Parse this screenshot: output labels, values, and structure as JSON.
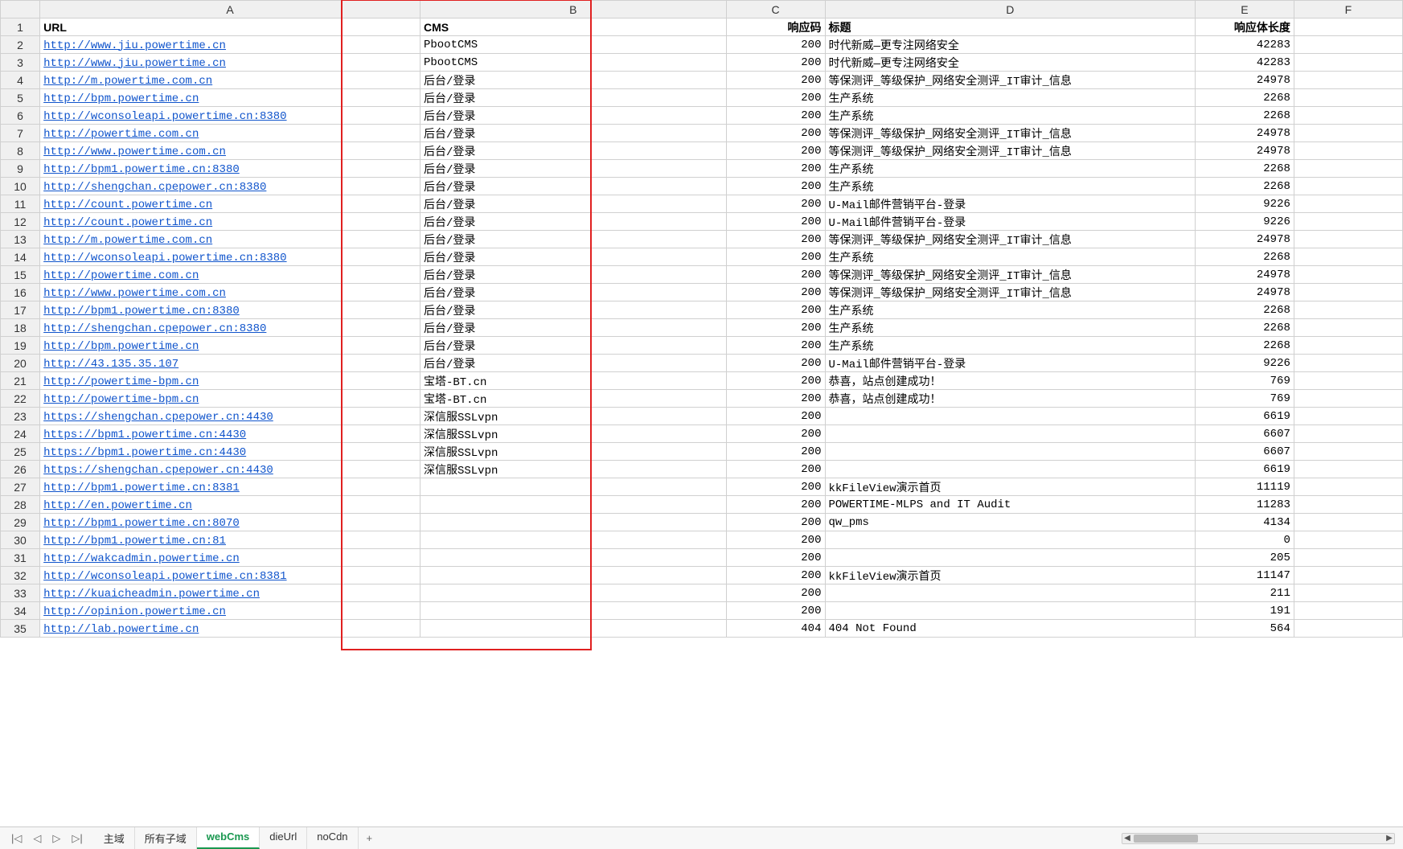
{
  "columns": [
    "A",
    "B",
    "C",
    "D",
    "E",
    "F"
  ],
  "headers": {
    "A": "URL",
    "B": "CMS",
    "C": "响应码",
    "D": "标题",
    "E": "响应体长度",
    "F": ""
  },
  "rows": [
    {
      "n": 2,
      "url": "http://www.jiu.powertime.cn",
      "cms": "PbootCMS",
      "code": "200",
      "title": "时代新威—更专注网络安全",
      "len": "42283"
    },
    {
      "n": 3,
      "url": "http://www.jiu.powertime.cn",
      "cms": "PbootCMS",
      "code": "200",
      "title": "时代新威—更专注网络安全",
      "len": "42283"
    },
    {
      "n": 4,
      "url": "http://m.powertime.com.cn",
      "cms": "后台/登录",
      "code": "200",
      "title": "等保测评_等级保护_网络安全测评_IT审计_信息",
      "len": "24978"
    },
    {
      "n": 5,
      "url": "http://bpm.powertime.cn",
      "cms": "后台/登录",
      "code": "200",
      "title": "生产系统",
      "len": "2268"
    },
    {
      "n": 6,
      "url": "http://wconsoleapi.powertime.cn:8380",
      "cms": "后台/登录",
      "code": "200",
      "title": "生产系统",
      "len": "2268"
    },
    {
      "n": 7,
      "url": "http://powertime.com.cn",
      "cms": "后台/登录",
      "code": "200",
      "title": "等保测评_等级保护_网络安全测评_IT审计_信息",
      "len": "24978"
    },
    {
      "n": 8,
      "url": "http://www.powertime.com.cn",
      "cms": "后台/登录",
      "code": "200",
      "title": "等保测评_等级保护_网络安全测评_IT审计_信息",
      "len": "24978"
    },
    {
      "n": 9,
      "url": "http://bpm1.powertime.cn:8380",
      "cms": "后台/登录",
      "code": "200",
      "title": "生产系统",
      "len": "2268"
    },
    {
      "n": 10,
      "url": "http://shengchan.cpepower.cn:8380",
      "cms": "后台/登录",
      "code": "200",
      "title": "生产系统",
      "len": "2268"
    },
    {
      "n": 11,
      "url": "http://count.powertime.cn",
      "cms": "后台/登录",
      "code": "200",
      "title": "U-Mail邮件营销平台-登录",
      "len": "9226"
    },
    {
      "n": 12,
      "url": "http://count.powertime.cn",
      "cms": "后台/登录",
      "code": "200",
      "title": "U-Mail邮件营销平台-登录",
      "len": "9226"
    },
    {
      "n": 13,
      "url": "http://m.powertime.com.cn",
      "cms": "后台/登录",
      "code": "200",
      "title": "等保测评_等级保护_网络安全测评_IT审计_信息",
      "len": "24978"
    },
    {
      "n": 14,
      "url": "http://wconsoleapi.powertime.cn:8380",
      "cms": "后台/登录",
      "code": "200",
      "title": "生产系统",
      "len": "2268"
    },
    {
      "n": 15,
      "url": "http://powertime.com.cn",
      "cms": "后台/登录",
      "code": "200",
      "title": "等保测评_等级保护_网络安全测评_IT审计_信息",
      "len": "24978"
    },
    {
      "n": 16,
      "url": "http://www.powertime.com.cn",
      "cms": "后台/登录",
      "code": "200",
      "title": "等保测评_等级保护_网络安全测评_IT审计_信息",
      "len": "24978"
    },
    {
      "n": 17,
      "url": "http://bpm1.powertime.cn:8380",
      "cms": "后台/登录",
      "code": "200",
      "title": "生产系统",
      "len": "2268"
    },
    {
      "n": 18,
      "url": "http://shengchan.cpepower.cn:8380",
      "cms": "后台/登录",
      "code": "200",
      "title": "生产系统",
      "len": "2268"
    },
    {
      "n": 19,
      "url": "http://bpm.powertime.cn",
      "cms": "后台/登录",
      "code": "200",
      "title": "生产系统",
      "len": "2268"
    },
    {
      "n": 20,
      "url": "http://43.135.35.107",
      "cms": "后台/登录",
      "code": "200",
      "title": "U-Mail邮件营销平台-登录",
      "len": "9226"
    },
    {
      "n": 21,
      "url": "http://powertime-bpm.cn",
      "cms": "宝塔-BT.cn",
      "code": "200",
      "title": "恭喜，站点创建成功！",
      "len": "769"
    },
    {
      "n": 22,
      "url": "http://powertime-bpm.cn",
      "cms": "宝塔-BT.cn",
      "code": "200",
      "title": "恭喜，站点创建成功！",
      "len": "769"
    },
    {
      "n": 23,
      "url": "https://shengchan.cpepower.cn:4430",
      "cms": "深信服SSLvpn",
      "code": "200",
      "title": "",
      "len": "6619"
    },
    {
      "n": 24,
      "url": "https://bpm1.powertime.cn:4430",
      "cms": "深信服SSLvpn",
      "code": "200",
      "title": "",
      "len": "6607"
    },
    {
      "n": 25,
      "url": "https://bpm1.powertime.cn:4430",
      "cms": "深信服SSLvpn",
      "code": "200",
      "title": "",
      "len": "6607"
    },
    {
      "n": 26,
      "url": "https://shengchan.cpepower.cn:4430",
      "cms": "深信服SSLvpn",
      "code": "200",
      "title": "",
      "len": "6619"
    },
    {
      "n": 27,
      "url": "http://bpm1.powertime.cn:8381",
      "cms": "",
      "code": "200",
      "title": "kkFileView演示首页",
      "len": "11119"
    },
    {
      "n": 28,
      "url": "http://en.powertime.cn",
      "cms": "",
      "code": "200",
      "title": "POWERTIME-MLPS and IT Audit",
      "len": "11283"
    },
    {
      "n": 29,
      "url": "http://bpm1.powertime.cn:8070",
      "cms": "",
      "code": "200",
      "title": "qw_pms",
      "len": "4134"
    },
    {
      "n": 30,
      "url": "http://bpm1.powertime.cn:81",
      "cms": "",
      "code": "200",
      "title": "",
      "len": "0"
    },
    {
      "n": 31,
      "url": "http://wakcadmin.powertime.cn",
      "cms": "",
      "code": "200",
      "title": "",
      "len": "205"
    },
    {
      "n": 32,
      "url": "http://wconsoleapi.powertime.cn:8381",
      "cms": "",
      "code": "200",
      "title": "kkFileView演示首页",
      "len": "11147"
    },
    {
      "n": 33,
      "url": "http://kuaicheadmin.powertime.cn",
      "cms": "",
      "code": "200",
      "title": "",
      "len": "211"
    },
    {
      "n": 34,
      "url": "http://opinion.powertime.cn",
      "cms": "",
      "code": "200",
      "title": "",
      "len": "191"
    },
    {
      "n": 35,
      "url": "http://lab.powertime.cn",
      "cms": "",
      "code": "404",
      "title": "404 Not Found",
      "len": "564"
    }
  ],
  "tabs": {
    "items": [
      "主域",
      "所有子域",
      "webCms",
      "dieUrl",
      "noCdn"
    ],
    "active_index": 2,
    "nav": {
      "first": "|◁",
      "prev": "◁",
      "next": "▷",
      "last": "▷|"
    },
    "add": "+"
  },
  "scroll": {
    "left_arrow": "◀",
    "right_arrow": "▶"
  }
}
